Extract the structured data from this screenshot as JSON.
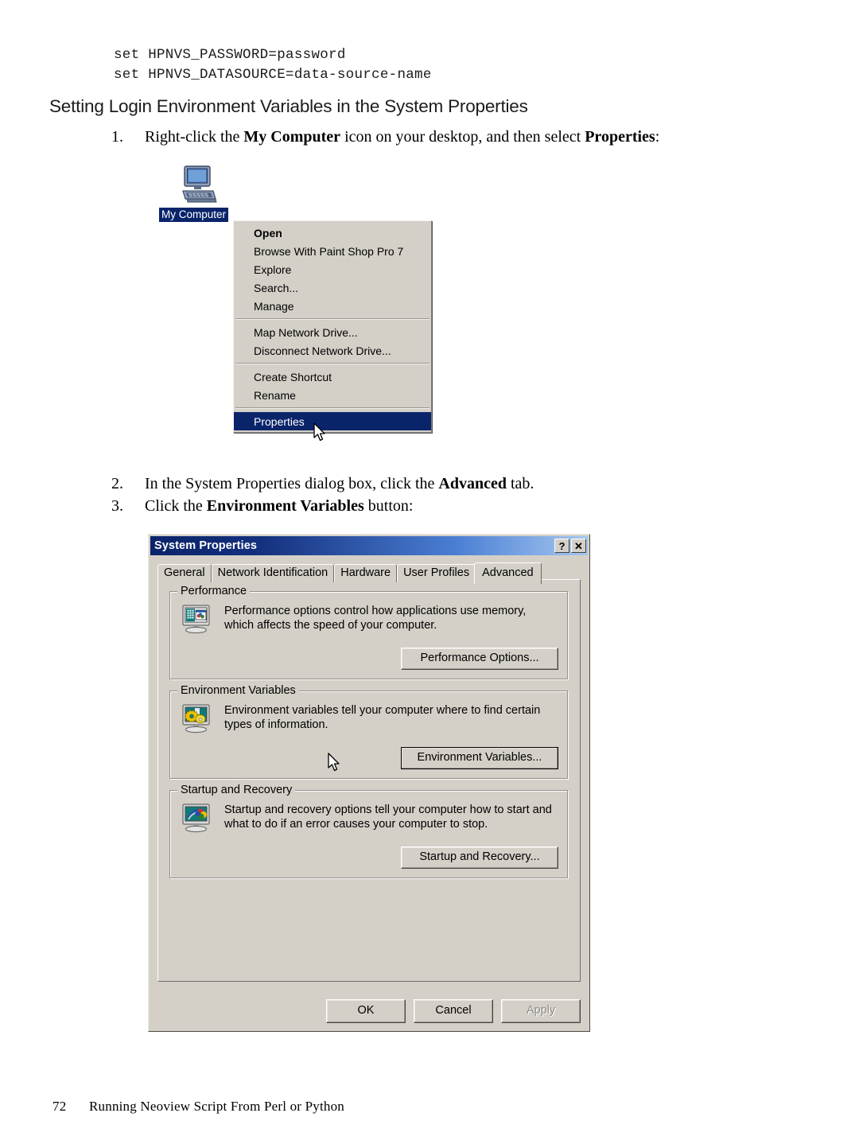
{
  "page": {
    "code_lines": "set HPNVS_PASSWORD=password\nset HPNVS_DATASOURCE=data-source-name",
    "heading": "Setting Login Environment Variables in the System Properties",
    "steps": [
      {
        "num": "1.",
        "html": "Right-click the <b>My Computer</b> icon on your desktop, and then select <b>Properties</b>:"
      },
      {
        "num": "2.",
        "html": "In the System Properties dialog box, click the <b>Advanced</b> tab."
      },
      {
        "num": "3.",
        "html": "Click the <b>Environment Variables</b> button:"
      }
    ],
    "footer": {
      "page_number": "72",
      "title": "Running Neoview Script From Perl or Python"
    }
  },
  "desktop_figure": {
    "icon_name": "my-computer-icon",
    "icon_label": "My Computer",
    "context_menu": {
      "groups": [
        [
          {
            "label": "Open",
            "bold": true,
            "selected": false
          },
          {
            "label": "Browse With Paint Shop Pro 7",
            "bold": false,
            "selected": false
          },
          {
            "label": "Explore",
            "bold": false,
            "selected": false
          },
          {
            "label": "Search...",
            "bold": false,
            "selected": false
          },
          {
            "label": "Manage",
            "bold": false,
            "selected": false
          }
        ],
        [
          {
            "label": "Map Network Drive...",
            "bold": false,
            "selected": false
          },
          {
            "label": "Disconnect Network Drive...",
            "bold": false,
            "selected": false
          }
        ],
        [
          {
            "label": "Create Shortcut",
            "bold": false,
            "selected": false
          },
          {
            "label": "Rename",
            "bold": false,
            "selected": false
          }
        ],
        [
          {
            "label": "Properties",
            "bold": false,
            "selected": true
          }
        ]
      ]
    }
  },
  "dialog": {
    "title": "System Properties",
    "titlebar_buttons": [
      {
        "name": "help-button",
        "glyph": "?"
      },
      {
        "name": "close-button",
        "glyph": "✕"
      }
    ],
    "tabs": [
      {
        "label": "General",
        "active": false
      },
      {
        "label": "Network Identification",
        "active": false
      },
      {
        "label": "Hardware",
        "active": false
      },
      {
        "label": "User Profiles",
        "active": false
      },
      {
        "label": "Advanced",
        "active": true
      }
    ],
    "groups": [
      {
        "title": "Performance",
        "icon": "performance-monitor-icon",
        "description": "Performance options control how applications use memory, which affects the speed of your computer.",
        "button": "Performance Options...",
        "button_focused": false
      },
      {
        "title": "Environment Variables",
        "icon": "environment-variables-gears-icon",
        "description": "Environment variables tell your computer where to find certain types of information.",
        "button": "Environment Variables...",
        "button_focused": true
      },
      {
        "title": "Startup and Recovery",
        "icon": "startup-recovery-monitor-icon",
        "description": "Startup and recovery options tell your computer how to start and what to do if an error causes your computer to stop.",
        "button": "Startup and Recovery...",
        "button_focused": false
      }
    ],
    "footer_buttons": [
      {
        "label": "OK",
        "disabled": false
      },
      {
        "label": "Cancel",
        "disabled": false
      },
      {
        "label": "Apply",
        "disabled": true
      }
    ]
  },
  "colors": {
    "titlebar_start": "#0a246a",
    "titlebar_end": "#a6c8f0",
    "face": "#d4d0c8",
    "selection": "#0a246a"
  }
}
